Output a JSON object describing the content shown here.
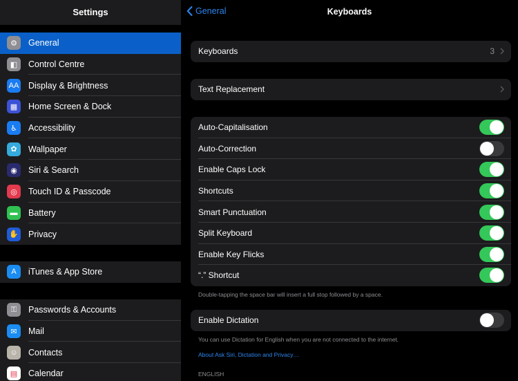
{
  "sidebar": {
    "title": "Settings",
    "groups": [
      {
        "items": [
          {
            "label": "General",
            "icon": "gear-icon",
            "color": "#8e8e93",
            "glyph": "⚙",
            "selected": true
          },
          {
            "label": "Control Centre",
            "icon": "toggles-icon",
            "color": "#8e8e93",
            "glyph": "◧"
          },
          {
            "label": "Display & Brightness",
            "icon": "text-size-icon",
            "color": "#1a7cf2",
            "glyph": "AA"
          },
          {
            "label": "Home Screen & Dock",
            "icon": "grid-icon",
            "color": "#3c52d6",
            "glyph": "▦"
          },
          {
            "label": "Accessibility",
            "icon": "accessibility-icon",
            "color": "#1a7cf2",
            "glyph": "♿"
          },
          {
            "label": "Wallpaper",
            "icon": "flower-icon",
            "color": "#35aadc",
            "glyph": "✿"
          },
          {
            "label": "Siri & Search",
            "icon": "siri-icon",
            "color": "#2a2a6e",
            "glyph": "◉"
          },
          {
            "label": "Touch ID & Passcode",
            "icon": "fingerprint-icon",
            "color": "#e33a4e",
            "glyph": "◎"
          },
          {
            "label": "Battery",
            "icon": "battery-icon",
            "color": "#30c150",
            "glyph": "▬"
          },
          {
            "label": "Privacy",
            "icon": "hand-icon",
            "color": "#1f5bd6",
            "glyph": "✋"
          }
        ]
      },
      {
        "items": [
          {
            "label": "iTunes & App Store",
            "icon": "app-store-icon",
            "color": "#1a8cf2",
            "glyph": "A"
          }
        ]
      },
      {
        "items": [
          {
            "label": "Passwords & Accounts",
            "icon": "key-icon",
            "color": "#8e8e93",
            "glyph": "⚿"
          },
          {
            "label": "Mail",
            "icon": "mail-icon",
            "color": "#1a8cf2",
            "glyph": "✉"
          },
          {
            "label": "Contacts",
            "icon": "contacts-icon",
            "color": "#b9b4aa",
            "glyph": "☺"
          },
          {
            "label": "Calendar",
            "icon": "calendar-icon",
            "color": "#ffffff",
            "glyph": "▤"
          }
        ]
      }
    ]
  },
  "nav": {
    "back_label": "General",
    "title": "Keyboards"
  },
  "keyboards_row": {
    "label": "Keyboards",
    "value": "3"
  },
  "text_replacement_row": {
    "label": "Text Replacement"
  },
  "toggles": [
    {
      "label": "Auto-Capitalisation",
      "on": true
    },
    {
      "label": "Auto-Correction",
      "on": false
    },
    {
      "label": "Enable Caps Lock",
      "on": true
    },
    {
      "label": "Shortcuts",
      "on": true
    },
    {
      "label": "Smart Punctuation",
      "on": true
    },
    {
      "label": "Split Keyboard",
      "on": true
    },
    {
      "label": "Enable Key Flicks",
      "on": true
    },
    {
      "label": "“.” Shortcut",
      "on": true
    }
  ],
  "shortcut_footnote": "Double-tapping the space bar will insert a full stop followed by a space.",
  "dictation": {
    "label": "Enable Dictation",
    "on": false,
    "footnote": "You can use Dictation for English when you are not connected to the internet.",
    "link": "About Ask Siri, Dictation and Privacy…"
  },
  "section_header": "ENGLISH",
  "colors": {
    "accent": "#2d86f0",
    "selected": "#0a60c8",
    "toggle_on": "#34c759",
    "toggle_off": "#3a3a3c"
  }
}
